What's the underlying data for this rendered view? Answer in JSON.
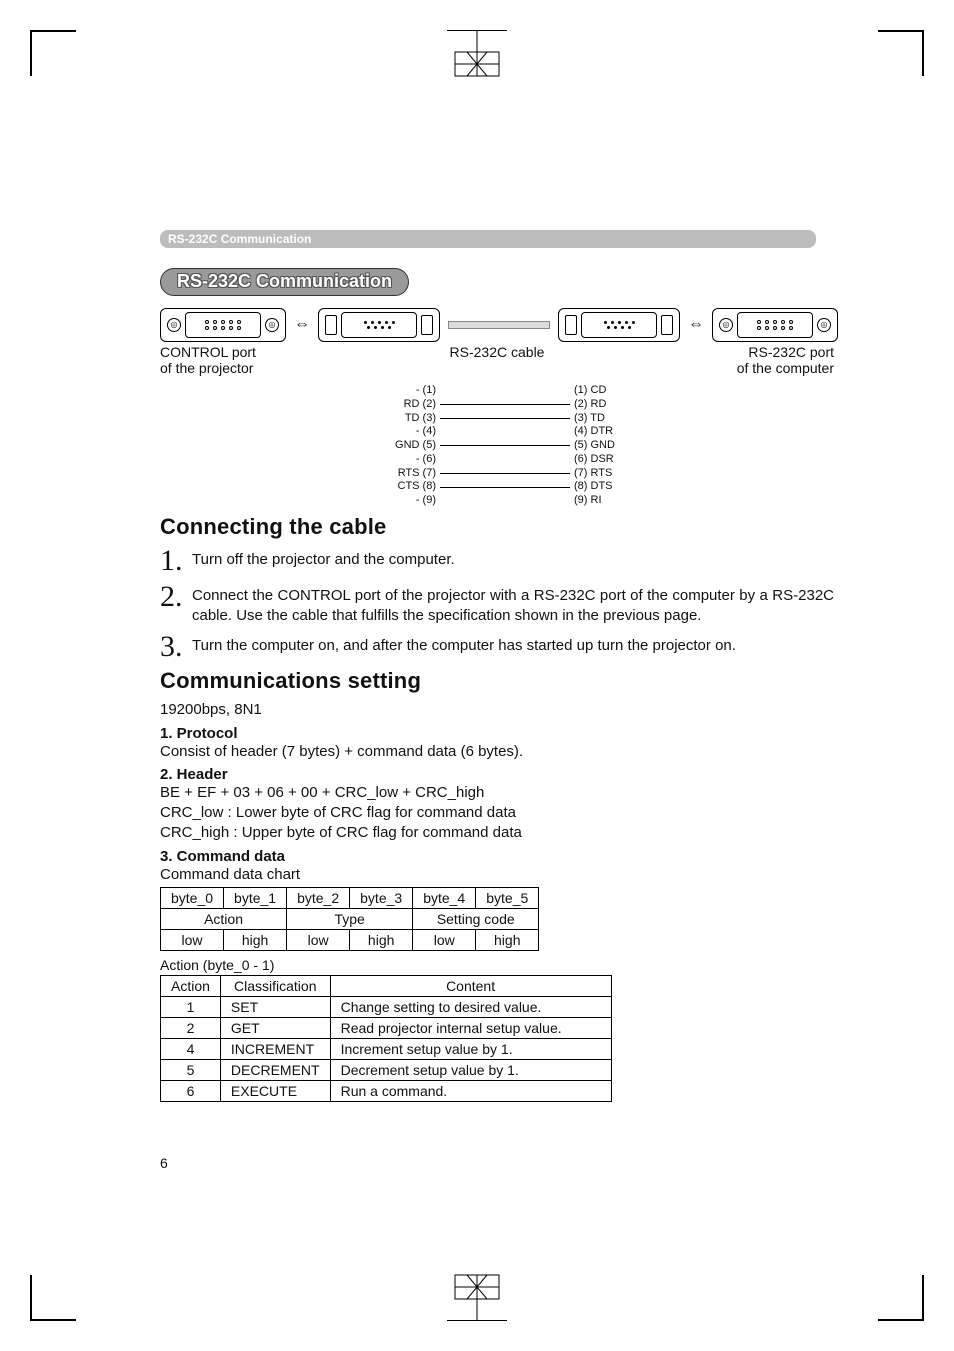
{
  "header_bar": "RS-232C Communication",
  "section_pill": "RS-232C Communication",
  "connectors": {
    "left_label_l1": "CONTROL port",
    "left_label_l2": "of the projector",
    "mid_label": "RS-232C cable",
    "right_label_l1": "RS-232C port",
    "right_label_l2": "of the computer"
  },
  "pinout": {
    "rows": [
      {
        "l": "- (1)",
        "wire": false,
        "r": "(1) CD"
      },
      {
        "l": "RD (2)",
        "wire": true,
        "r": "(2) RD"
      },
      {
        "l": "TD (3)",
        "wire": true,
        "r": "(3) TD"
      },
      {
        "l": "- (4)",
        "wire": false,
        "r": "(4) DTR"
      },
      {
        "l": "GND (5)",
        "wire": true,
        "r": "(5) GND"
      },
      {
        "l": "- (6)",
        "wire": false,
        "r": "(6) DSR"
      },
      {
        "l": "RTS (7)",
        "wire": true,
        "r": "(7) RTS"
      },
      {
        "l": "CTS (8)",
        "wire": true,
        "r": "(8) DTS"
      },
      {
        "l": "- (9)",
        "wire": false,
        "r": "(9) RI"
      }
    ]
  },
  "sec_connecting": {
    "title": "Connecting the cable",
    "steps": [
      {
        "n": "1",
        "text": "Turn off the projector and the computer."
      },
      {
        "n": "2",
        "text": "Connect the CONTROL port of the projector with a RS-232C port of the computer by a RS-232C cable. Use the cable that fulfills the specification shown in the previous page."
      },
      {
        "n": "3",
        "text": "Turn the computer on, and after the computer has started up turn the projector on."
      }
    ]
  },
  "sec_comm": {
    "title": "Communications setting",
    "baud": "19200bps, 8N1",
    "h1": "1. Protocol",
    "h1_text": "Consist of header (7 bytes) + command data (6 bytes).",
    "h2": "2. Header",
    "h2_line1": "BE + EF + 03 + 06 + 00 + CRC_low + CRC_high",
    "h2_line2": "CRC_low : Lower byte of CRC flag for command data",
    "h2_line3": "CRC_high : Upper byte of CRC flag for command data",
    "h3": "3. Command data",
    "h3_caption": "Command data chart",
    "table1": {
      "r1": [
        "byte_0",
        "byte_1",
        "byte_2",
        "byte_3",
        "byte_4",
        "byte_5"
      ],
      "r2": [
        "Action",
        "Type",
        "Setting code"
      ],
      "r3": [
        "low",
        "high",
        "low",
        "high",
        "low",
        "high"
      ]
    },
    "action_caption": "Action (byte_0 - 1)",
    "table2": {
      "head": [
        "Action",
        "Classification",
        "Content"
      ],
      "rows": [
        [
          "1",
          "SET",
          "Change setting to desired value."
        ],
        [
          "2",
          "GET",
          "Read projector internal setup value."
        ],
        [
          "4",
          "INCREMENT",
          "Increment setup value by 1."
        ],
        [
          "5",
          "DECREMENT",
          "Decrement setup value by 1."
        ],
        [
          "6",
          "EXECUTE",
          "Run a command."
        ]
      ]
    }
  },
  "page_number": "6"
}
